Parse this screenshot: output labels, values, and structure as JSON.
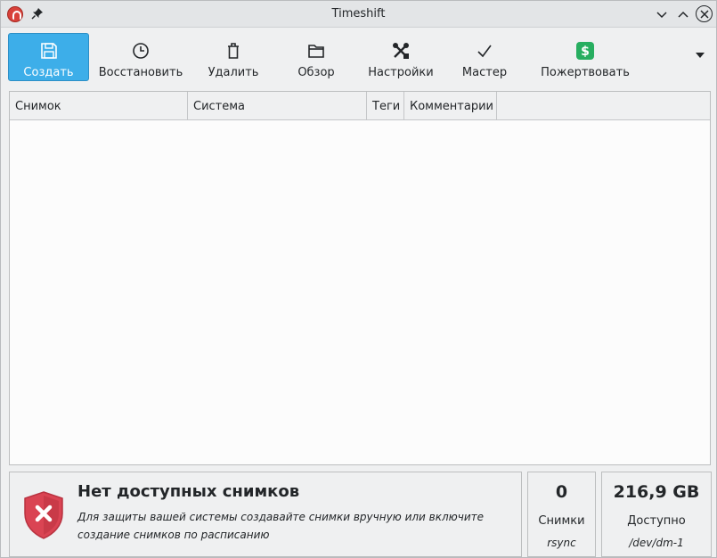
{
  "window": {
    "title": "Timeshift"
  },
  "toolbar": {
    "items": [
      {
        "label": "Создать",
        "icon": "save-icon",
        "active": true
      },
      {
        "label": "Восстановить",
        "icon": "clock-icon"
      },
      {
        "label": "Удалить",
        "icon": "trash-icon"
      },
      {
        "label": "Обзор",
        "icon": "folder-icon"
      },
      {
        "label": "Настройки",
        "icon": "tools-icon"
      },
      {
        "label": "Мастер",
        "icon": "checkmark-icon"
      },
      {
        "label": "Пожертвовать",
        "icon": "dollar-icon"
      }
    ]
  },
  "table": {
    "columns": [
      "Снимок",
      "Система",
      "Теги",
      "Комментарии"
    ],
    "rows": []
  },
  "status": {
    "title": "Нет доступных снимков",
    "message": "Для защиты вашей системы создавайте снимки вручную или включите создание снимков по расписанию",
    "snapshots_count": "0",
    "snapshots_label": "Снимки",
    "snapshots_mode": "rsync",
    "free_space": "216,9 GB",
    "free_label": "Доступно",
    "device": "/dev/dm-1"
  },
  "colors": {
    "accent": "#3daee9",
    "danger": "#da4453",
    "donate": "#27ae60"
  }
}
